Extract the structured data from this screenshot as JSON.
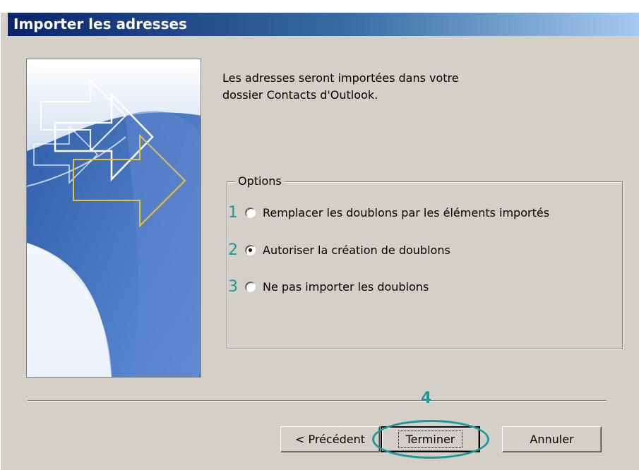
{
  "dialog": {
    "title": "Importer les adresses",
    "intro_text": "Les adresses seront importées dans votre\ndossier Contacts d'Outlook."
  },
  "options": {
    "legend": "Options",
    "items": [
      {
        "step": "1",
        "label": "Remplacer les doublons par les éléments importés",
        "checked": false
      },
      {
        "step": "2",
        "label": "Autoriser la création de doublons",
        "checked": true
      },
      {
        "step": "3",
        "label": "Ne pas importer les doublons",
        "checked": false
      }
    ]
  },
  "buttons": {
    "back": "< Précédent",
    "finish": "Terminer",
    "cancel": "Annuler"
  },
  "annotations": {
    "finish_step": "4",
    "accent_color": "#1a9a9a"
  },
  "colors": {
    "dialog_background": "#d4d0c8",
    "title_gradient_start": "#0a246a",
    "title_gradient_end": "#a6caf0"
  },
  "icons": {
    "wizard_image": "blue-arrows-wizard-graphic"
  }
}
